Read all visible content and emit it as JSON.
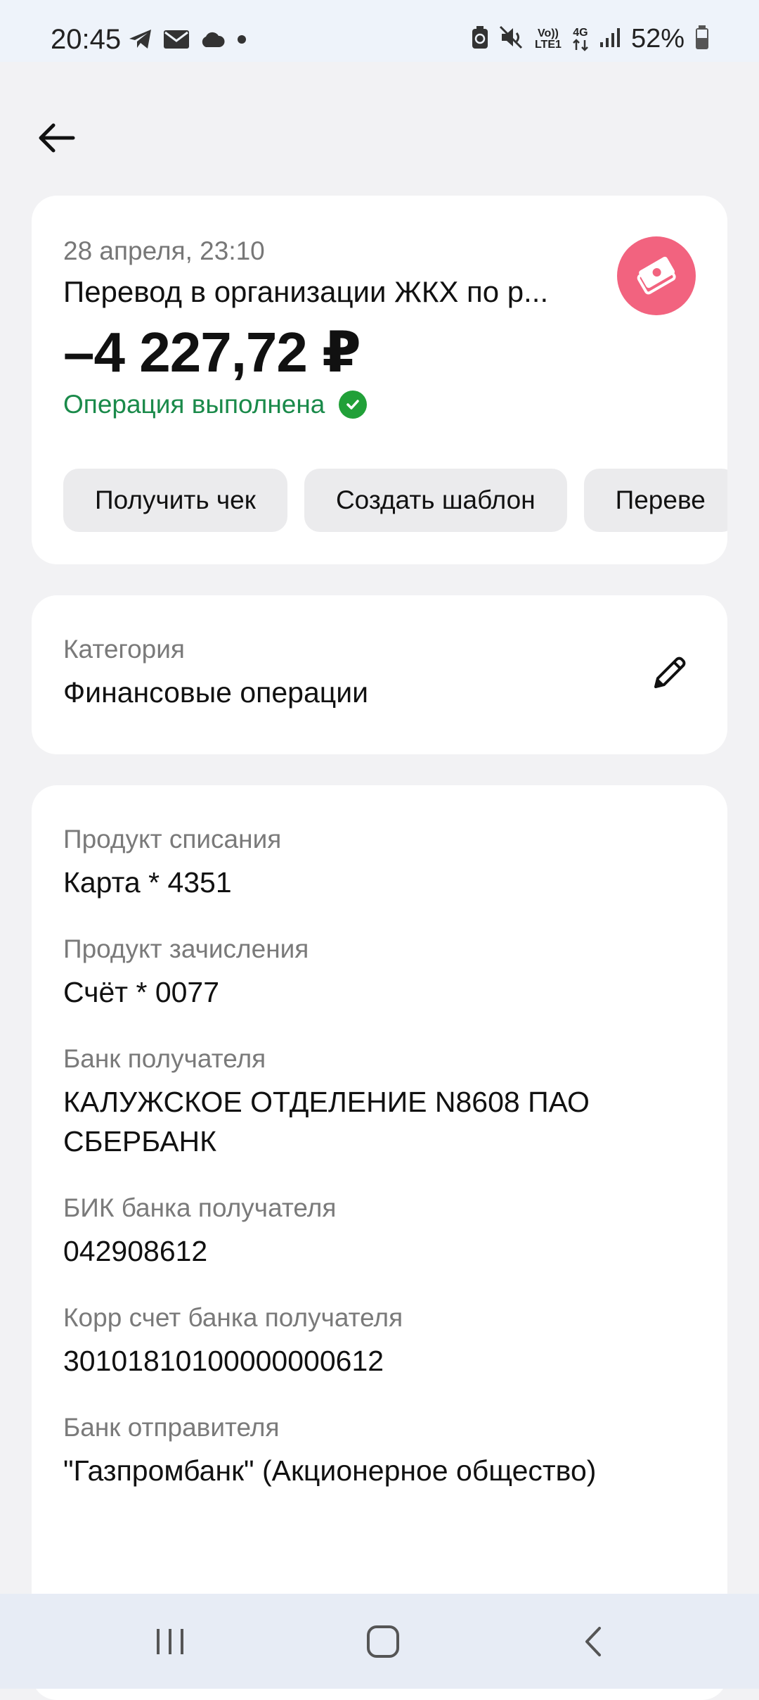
{
  "status_bar": {
    "time": "20:45",
    "battery_percent": "52%",
    "volte_label": "Vo)) LTE1",
    "network_label": "4G",
    "icons": [
      "telegram-icon",
      "mail-icon",
      "cloud-icon",
      "dot-icon",
      "battery-saver-icon",
      "mute-icon",
      "signal-icon",
      "battery-icon"
    ]
  },
  "operation": {
    "date": "28 апреля, 23:10",
    "title": "Перевод в организации ЖКХ по р...",
    "amount": "–4 227,72 ₽",
    "status": "Операция выполнена",
    "status_color": "#1a8a4a",
    "icon": "banknote-icon",
    "icon_color": "#f2637f"
  },
  "actions": [
    {
      "label": "Получить чек"
    },
    {
      "label": "Создать шаблон"
    },
    {
      "label": "Переве"
    }
  ],
  "category": {
    "label": "Категория",
    "value": "Финансовые операции"
  },
  "details": [
    {
      "label": "Продукт списания",
      "value": "Карта * 4351"
    },
    {
      "label": "Продукт зачисления",
      "value": "Счёт * 0077"
    },
    {
      "label": "Банк получателя",
      "value": "КАЛУЖСКОЕ ОТДЕЛЕНИЕ N8608 ПАО СБЕРБАНК"
    },
    {
      "label": "БИК банка получателя",
      "value": "042908612"
    },
    {
      "label": "Корр счет банка получателя",
      "value": "30101810100000000612"
    },
    {
      "label": "Банк отправителя",
      "value": "\"Газпромбанк\" (Акционерное общество)"
    }
  ]
}
